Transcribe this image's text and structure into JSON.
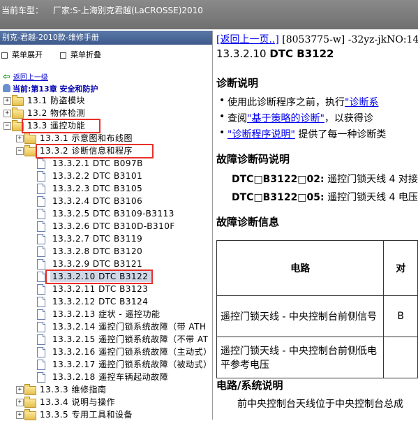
{
  "titlebar": {
    "model_label": "当前车型：",
    "maker": "厂家:S-上海别克君越(LaCROSSE)2010"
  },
  "left_panel": {
    "title": "别克-君越-2010款-维修手册",
    "expand_all": "菜单展开",
    "collapse_all": "菜单折叠",
    "back": "返回上一级",
    "current": "当前:第13章 安全和防护",
    "tree": [
      {
        "label": "13.1 防盗模块",
        "level": 0,
        "type": "folder",
        "toggle": "+"
      },
      {
        "label": "13.2 物体检测",
        "level": 0,
        "type": "folder",
        "toggle": "+"
      },
      {
        "label": "13.3 遥控功能",
        "level": 0,
        "type": "folder",
        "toggle": "-"
      },
      {
        "label": "13.3.1 示意图和布线图",
        "level": 1,
        "type": "folder",
        "toggle": "+"
      },
      {
        "label": "13.3.2 诊断信息和程序",
        "level": 1,
        "type": "folder",
        "toggle": "-"
      },
      {
        "label": "13.3.2.1 DTC B097B",
        "level": 2,
        "type": "doc"
      },
      {
        "label": "13.3.2.2 DTC B3101",
        "level": 2,
        "type": "doc"
      },
      {
        "label": "13.3.2.3 DTC B3105",
        "level": 2,
        "type": "doc"
      },
      {
        "label": "13.3.2.4 DTC B3106",
        "level": 2,
        "type": "doc"
      },
      {
        "label": "13.3.2.5 DTC B3109-B3113",
        "level": 2,
        "type": "doc"
      },
      {
        "label": "13.3.2.6 DTC B310D-B310F",
        "level": 2,
        "type": "doc"
      },
      {
        "label": "13.3.2.7 DTC B3119",
        "level": 2,
        "type": "doc"
      },
      {
        "label": "13.3.2.8 DTC B3120",
        "level": 2,
        "type": "doc"
      },
      {
        "label": "13.3.2.9 DTC B3121",
        "level": 2,
        "type": "doc"
      },
      {
        "label": "13.3.2.10 DTC B3122",
        "level": 2,
        "type": "doc",
        "selected": true
      },
      {
        "label": "13.3.2.11 DTC B3123",
        "level": 2,
        "type": "doc"
      },
      {
        "label": "13.3.2.12 DTC B3124",
        "level": 2,
        "type": "doc"
      },
      {
        "label": "13.3.2.13 症状 - 遥控功能",
        "level": 2,
        "type": "doc"
      },
      {
        "label": "13.3.2.14 遥控门锁系统故障（带 ATH",
        "level": 2,
        "type": "doc"
      },
      {
        "label": "13.3.2.15 遥控门锁系统故障（不带 AT",
        "level": 2,
        "type": "doc"
      },
      {
        "label": "13.3.2.16 遥控门锁系统故障（主动式）",
        "level": 2,
        "type": "doc"
      },
      {
        "label": "13.3.2.17 遥控门锁系统故障（被动式）",
        "level": 2,
        "type": "doc"
      },
      {
        "label": "13.3.2.18 遥控车辆起动故障",
        "level": 2,
        "type": "doc"
      },
      {
        "label": "13.3.3 维修指南",
        "level": 1,
        "type": "folder",
        "toggle": "+"
      },
      {
        "label": "13.3.4 说明与操作",
        "level": 1,
        "type": "folder",
        "toggle": "+"
      },
      {
        "label": "13.3.5 专用工具和设备",
        "level": 1,
        "type": "folder",
        "toggle": "+"
      }
    ]
  },
  "content": {
    "nav_back": "[返回上一页..]",
    "nav_info": " [8053775-w] -32yz-jkNO:14",
    "doc_code": "13.3.2.10",
    "doc_title": "DTC B3122",
    "diag_heading": "诊断说明",
    "bullets": [
      {
        "pre": "使用此诊断程序之前，执行",
        "link": "\"诊断系",
        "post": ""
      },
      {
        "pre": "查阅",
        "link": "\"基于策略的诊断\"",
        "post": "，以获得诊"
      },
      {
        "pre": "",
        "link": "\"诊断程序说明\"",
        "post": " 提供了每一种诊断类"
      }
    ],
    "dtc_heading": "故障诊断码说明",
    "dtcs": [
      {
        "code": "DTC□B3122□02:",
        "desc": " 遥控门锁天线 4 对接"
      },
      {
        "code": "DTC□B3122□05:",
        "desc": " 遥控门锁天线 4 电压"
      }
    ],
    "fault_heading": "故障诊断信息",
    "table": {
      "col_circuit": "电路",
      "col_next": "对",
      "rows": [
        {
          "circuit": "遥控门锁天线 - 中央控制台前侧信号",
          "next": "B"
        },
        {
          "circuit": "遥控门锁天线 - 中央控制台前侧低电平参考电压",
          "next": ""
        }
      ]
    },
    "system_heading": "电路/系统说明",
    "system_text": "前中央控制台天线位于中央控制台总成"
  }
}
